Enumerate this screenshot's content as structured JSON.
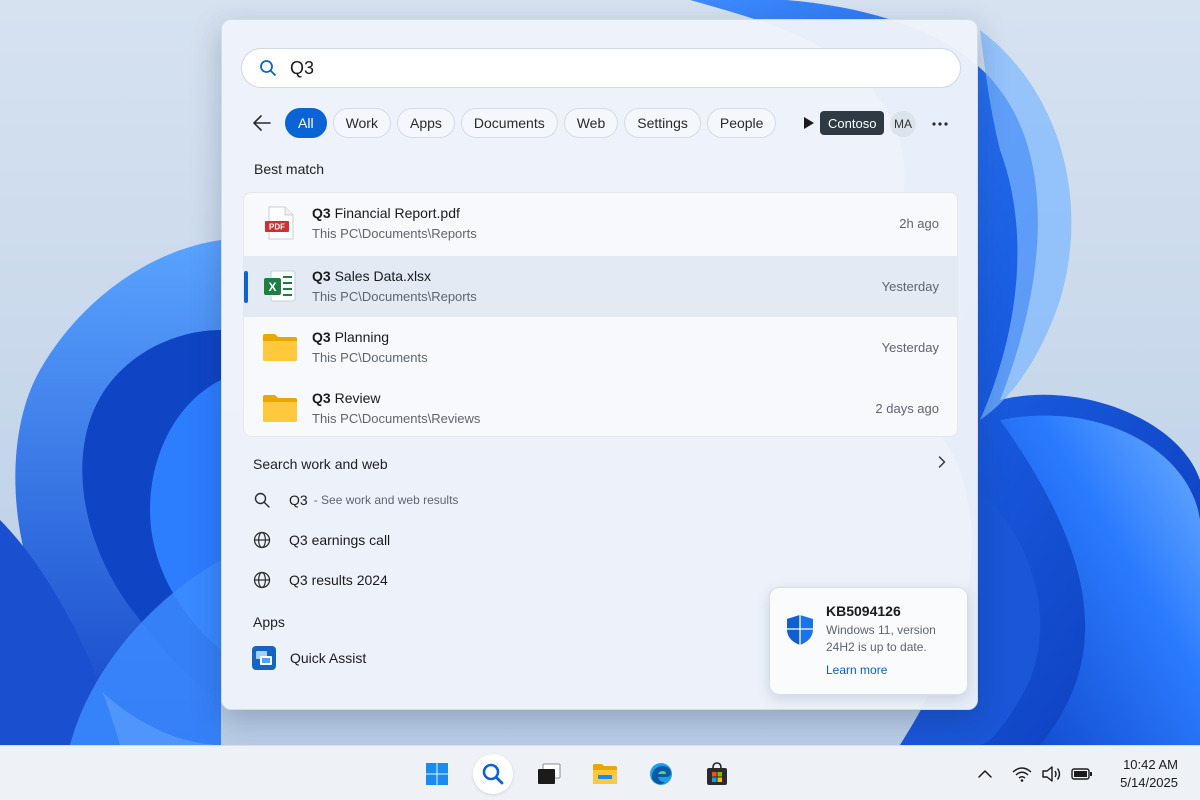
{
  "search": {
    "query": "Q3",
    "placeholder": ""
  },
  "filters": {
    "back_icon": "arrow-left-icon",
    "chips": [
      "All",
      "Work",
      "Apps",
      "Documents",
      "Web",
      "Settings",
      "People"
    ],
    "active": "All",
    "more_filters_icon": "play-icon",
    "org": "Contoso",
    "avatar_initials": "MA",
    "more_icon": "more-horizontal-icon"
  },
  "best_match": {
    "title": "Best match",
    "items": [
      {
        "bold": "Q3",
        "rest": " Financial Report.pdf",
        "path": "This PC\\Documents\\Reports",
        "time": "2h ago",
        "icon": "pdf-file-icon"
      },
      {
        "bold": "Q3",
        "rest": " Sales Data.xlsx",
        "path": "This PC\\Documents\\Reports",
        "time": "Yesterday",
        "icon": "excel-file-icon",
        "selected": true
      },
      {
        "bold": "Q3",
        "rest": " Planning",
        "path": "This PC\\Documents",
        "time": "Yesterday",
        "icon": "folder-icon"
      },
      {
        "bold": "Q3",
        "rest": " Review",
        "path": "This PC\\Documents\\Reviews",
        "time": "2 days ago",
        "icon": "folder-icon"
      }
    ]
  },
  "search_web": {
    "title": "Search work and web",
    "items": [
      {
        "text": "Q3",
        "sub": "- See work and web results",
        "icon": "search-icon"
      },
      {
        "text": "Q3 earnings call",
        "sub": "",
        "icon": "globe-icon"
      },
      {
        "text": "Q3 results 2024",
        "sub": "",
        "icon": "globe-icon"
      }
    ]
  },
  "apps": {
    "title": "Apps",
    "items": [
      {
        "text": "Quick Assist",
        "icon": "quick-assist-icon"
      }
    ]
  },
  "toast": {
    "title": "KB5094126",
    "body": "Windows 11, version 24H2 is up to date.",
    "link": "Learn more",
    "icon": "shield-icon"
  },
  "taskbar": {
    "apps": [
      "windows-start-icon",
      "search-icon",
      "task-view-icon",
      "file-explorer-icon",
      "edge-icon",
      "store-icon"
    ],
    "tray": [
      "chevron-up-icon",
      "wifi-icon",
      "volume-icon",
      "battery-icon"
    ],
    "time": "10:42 AM",
    "date": "5/14/2025"
  },
  "colors": {
    "accent": "#0a64d6",
    "wallpaper_blue": "#1f5fe0"
  }
}
